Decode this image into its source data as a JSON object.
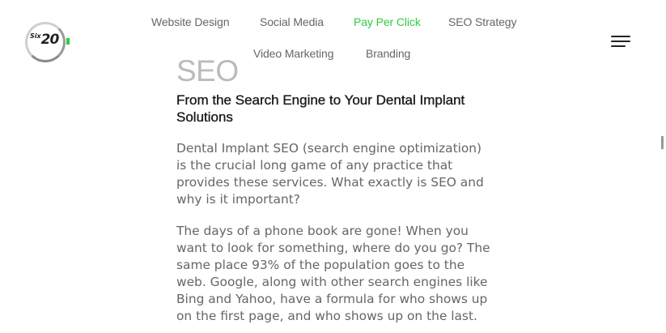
{
  "logo": {
    "six_text": "Six",
    "num_text": "20",
    "accent_color": "#2ecc40"
  },
  "nav": {
    "items": [
      {
        "label": "Website Design",
        "active": false
      },
      {
        "label": "Social Media",
        "active": false
      },
      {
        "label": "Pay Per Click",
        "active": true
      },
      {
        "label": "SEO Strategy",
        "active": false
      },
      {
        "label": "Video Marketing",
        "active": false
      },
      {
        "label": "Branding",
        "active": false
      }
    ],
    "menu_icon": "hamburger-menu-icon"
  },
  "content": {
    "title": "SEO",
    "subtitle": "From the Search Engine to Your Dental Implant Solutions",
    "paragraph_1": "Dental Implant SEO (search engine optimization) is the crucial long game of any practice that provides these services. What exactly is SEO and why is it important?",
    "paragraph_2": "The days of a phone book are gone! When you want to look for something, where do you go? The same place 93% of the population goes to the web. Google, along with other search engines like Bing and Yahoo, have a formula for who shows up on the first page, and who shows up on the last."
  },
  "colors": {
    "accent": "#2ecc40",
    "nav_text": "#666666",
    "heading_muted": "#bbbbbb",
    "body_text": "#666666",
    "subheading": "#1a1a1a"
  }
}
